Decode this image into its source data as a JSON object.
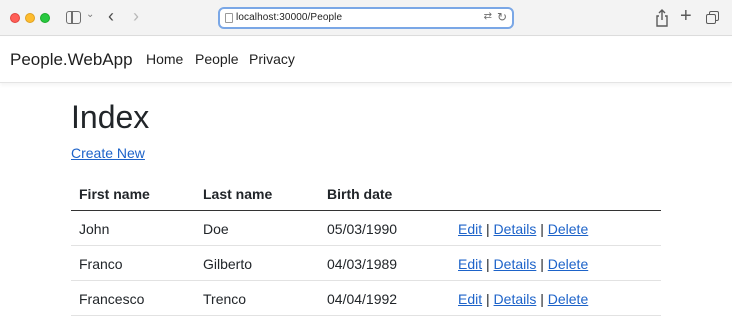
{
  "browser": {
    "url": "localhost:30000/People",
    "colors": {
      "traffic_red": "#ff5f57",
      "traffic_yellow": "#febc2e",
      "traffic_green": "#28c840",
      "url_focus": "#7aa7e6"
    }
  },
  "navbar": {
    "brand": "People.WebApp",
    "links": [
      "Home",
      "People",
      "Privacy"
    ]
  },
  "main": {
    "title": "Index",
    "create_link": "Create New",
    "table": {
      "headers": [
        "First name",
        "Last name",
        "Birth date"
      ],
      "rows": [
        {
          "first": "John",
          "last": "Doe",
          "birth": "05/03/1990"
        },
        {
          "first": "Franco",
          "last": "Gilberto",
          "birth": "04/03/1989"
        },
        {
          "first": "Francesco",
          "last": "Trenco",
          "birth": "04/04/1992"
        }
      ],
      "actions": {
        "edit": "Edit",
        "details": "Details",
        "delete": "Delete",
        "separator": "|"
      }
    },
    "link_color": "#1d63c9"
  }
}
